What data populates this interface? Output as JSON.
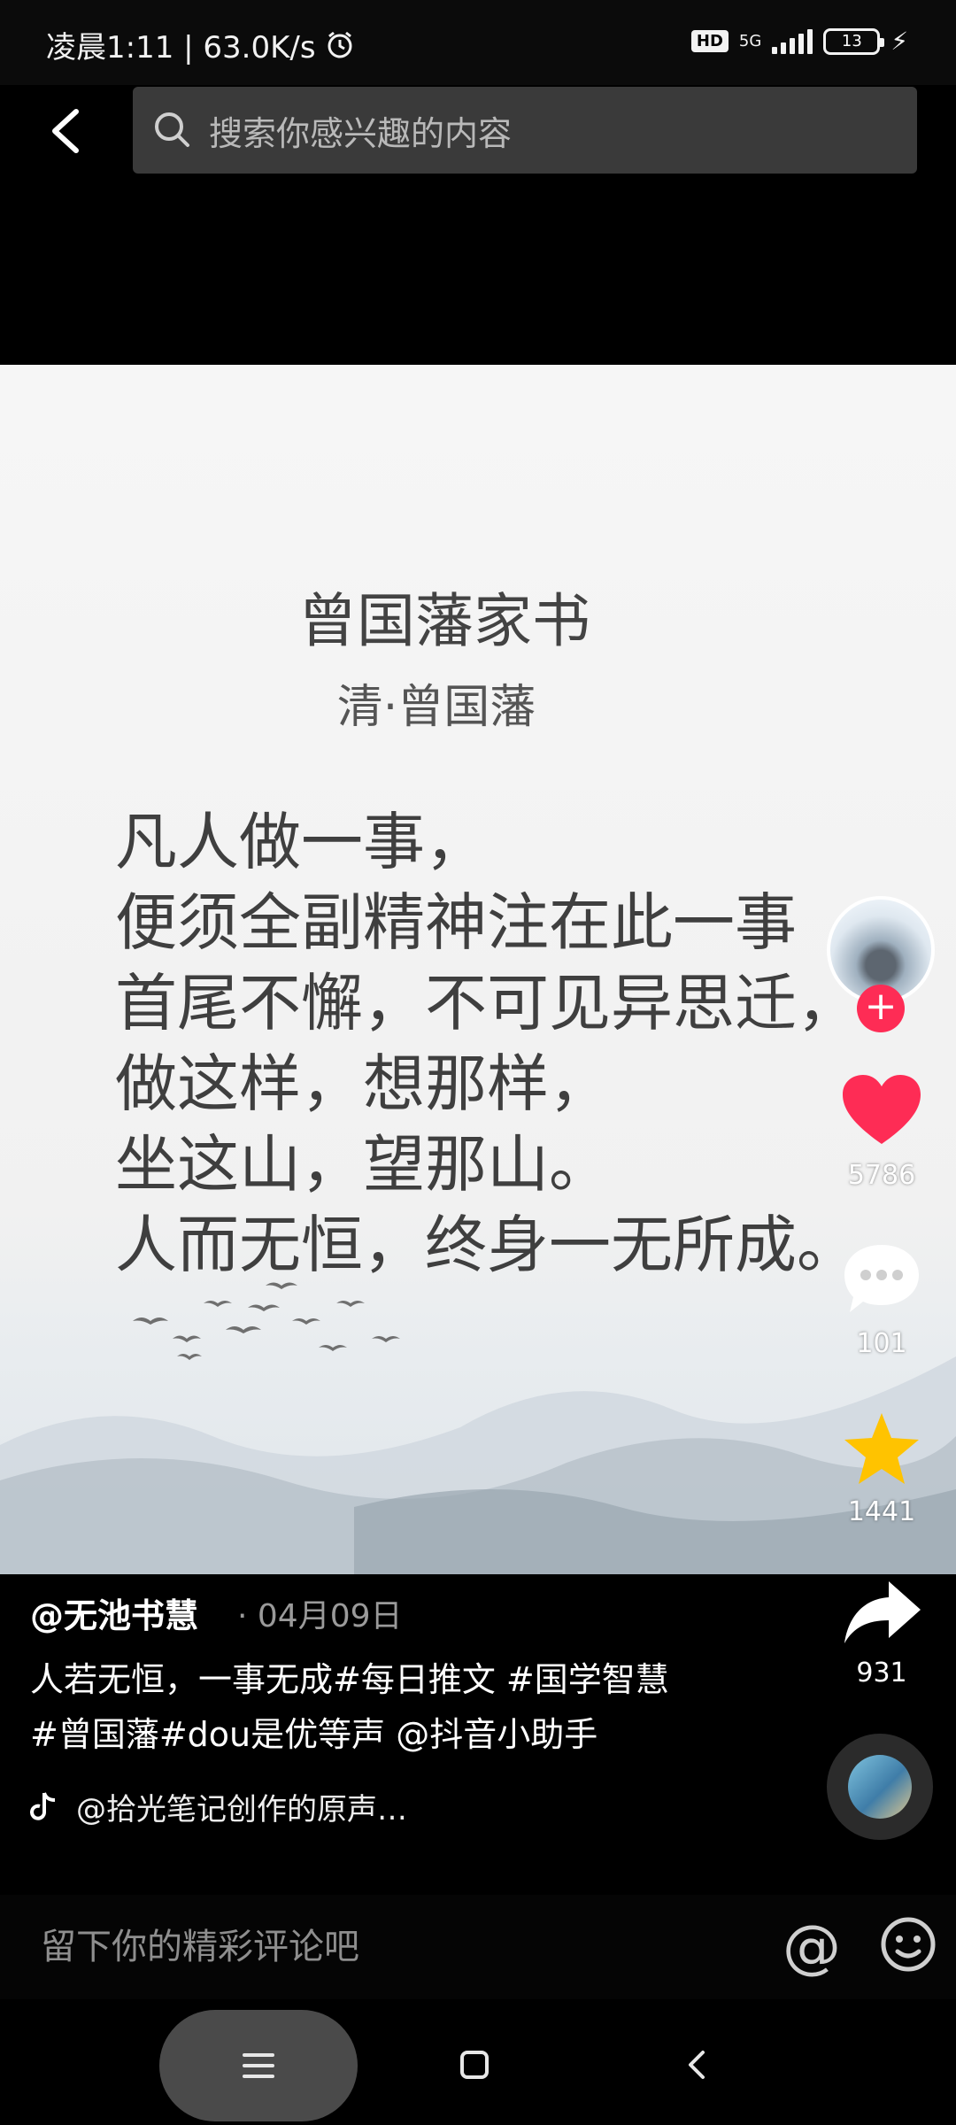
{
  "status_bar": {
    "time_speed": "凌晨1:11 | 63.0K/s",
    "alarm_icon": "alarm-clock-icon",
    "hd": "HD",
    "network": "5G",
    "battery": "13"
  },
  "search": {
    "placeholder": "搜索你感兴趣的内容"
  },
  "poem": {
    "title": "曾国藩家书",
    "author": "清·曾国藩",
    "lines": [
      "凡人做一事，",
      "便须全副精神注在此一事",
      "首尾不懈，不可见异思迁，",
      "做这样，想那样，",
      "坐这山，望那山。",
      "人而无恒，终身一无所成。"
    ]
  },
  "actions": {
    "likes": "5786",
    "comments": "101",
    "favorites": "1441",
    "shares": "931"
  },
  "post": {
    "author": "@无池书慧",
    "date": "· 04月09日",
    "caption_line1": "人若无恒，一事无成#每日推文 #国学智慧",
    "caption_line2": "#曾国藩#dou是优等声 @抖音小助手",
    "music": "@拾光笔记创作的原声…"
  },
  "comment": {
    "placeholder": "留下你的精彩评论吧",
    "at_symbol": "@"
  },
  "colors": {
    "like": "#fe2c55",
    "favorite": "#ffc300",
    "accent": "#fe2c55"
  }
}
